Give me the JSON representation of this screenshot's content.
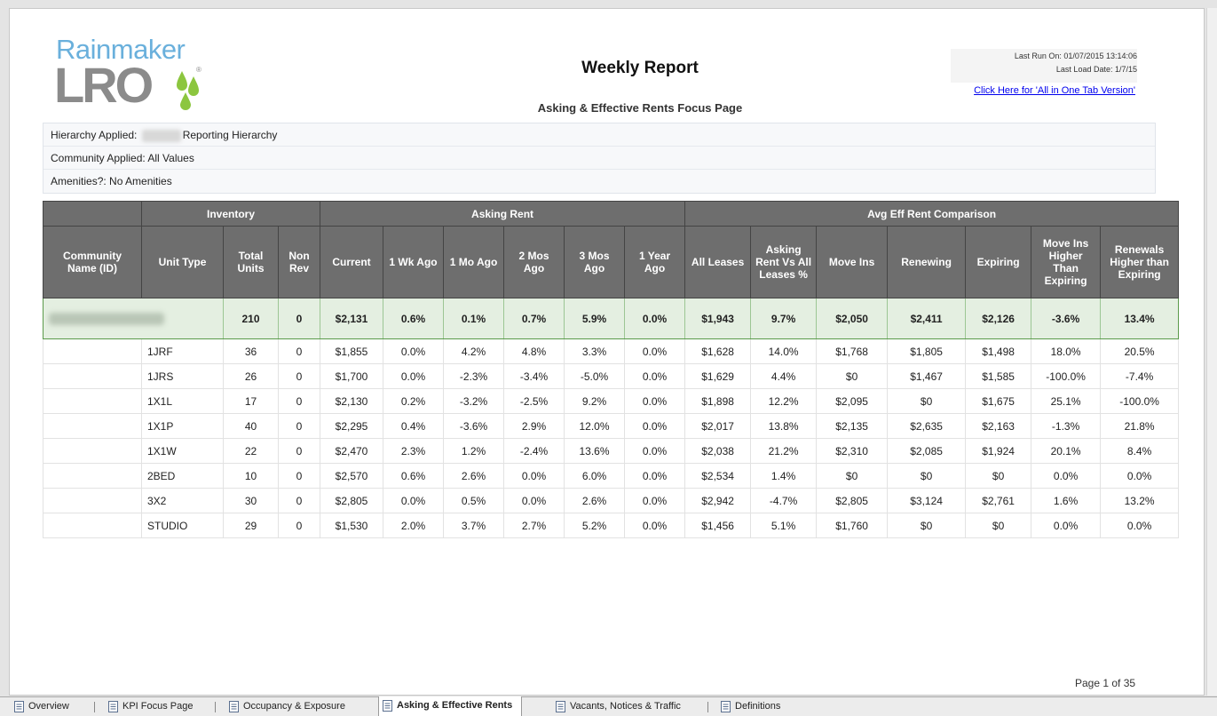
{
  "report": {
    "title": "Weekly Report",
    "subtitle": "Asking & Effective Rents Focus Page",
    "last_run": "Last Run On: 01/07/2015 13:14:06",
    "last_load": "Last Load Date: 1/7/15",
    "all_in_one_link": "Click Here for 'All in One Tab Version'",
    "page_indicator": "Page 1 of 35"
  },
  "logo": {
    "top_text": "Rainmaker",
    "bottom_text": "LRO",
    "reg_mark": "®"
  },
  "filters": {
    "hierarchy_label": "Hierarchy Applied: ",
    "hierarchy_value": "Reporting Hierarchy",
    "community": "Community Applied: All Values",
    "amenities": "Amenities?: No Amenities"
  },
  "table": {
    "group_headers": [
      "Inventory",
      "Asking Rent",
      "Avg Eff Rent Comparison"
    ],
    "columns": [
      "Community Name (ID)",
      "Unit Type",
      "Total Units",
      "Non Rev",
      "Current",
      "1 Wk Ago",
      "1 Mo Ago",
      "2 Mos Ago",
      "3 Mos Ago",
      "1 Year Ago",
      "All Leases",
      "Asking Rent Vs All Leases %",
      "Move Ins",
      "Renewing",
      "Expiring",
      "Move Ins Higher Than Expiring",
      "Renewals Higher than Expiring"
    ],
    "summary": [
      "",
      "210",
      "0",
      "$2,131",
      "0.6%",
      "0.1%",
      "0.7%",
      "5.9%",
      "0.0%",
      "$1,943",
      "9.7%",
      "$2,050",
      "$2,411",
      "$2,126",
      "-3.6%",
      "13.4%"
    ],
    "rows": [
      [
        "",
        "1JRF",
        "36",
        "0",
        "$1,855",
        "0.0%",
        "4.2%",
        "4.8%",
        "3.3%",
        "0.0%",
        "$1,628",
        "14.0%",
        "$1,768",
        "$1,805",
        "$1,498",
        "18.0%",
        "20.5%"
      ],
      [
        "",
        "1JRS",
        "26",
        "0",
        "$1,700",
        "0.0%",
        "-2.3%",
        "-3.4%",
        "-5.0%",
        "0.0%",
        "$1,629",
        "4.4%",
        "$0",
        "$1,467",
        "$1,585",
        "-100.0%",
        "-7.4%"
      ],
      [
        "",
        "1X1L",
        "17",
        "0",
        "$2,130",
        "0.2%",
        "-3.2%",
        "-2.5%",
        "9.2%",
        "0.0%",
        "$1,898",
        "12.2%",
        "$2,095",
        "$0",
        "$1,675",
        "25.1%",
        "-100.0%"
      ],
      [
        "",
        "1X1P",
        "40",
        "0",
        "$2,295",
        "0.4%",
        "-3.6%",
        "2.9%",
        "12.0%",
        "0.0%",
        "$2,017",
        "13.8%",
        "$2,135",
        "$2,635",
        "$2,163",
        "-1.3%",
        "21.8%"
      ],
      [
        "",
        "1X1W",
        "22",
        "0",
        "$2,470",
        "2.3%",
        "1.2%",
        "-2.4%",
        "13.6%",
        "0.0%",
        "$2,038",
        "21.2%",
        "$2,310",
        "$2,085",
        "$1,924",
        "20.1%",
        "8.4%"
      ],
      [
        "",
        "2BED",
        "10",
        "0",
        "$2,570",
        "0.6%",
        "2.6%",
        "0.0%",
        "6.0%",
        "0.0%",
        "$2,534",
        "1.4%",
        "$0",
        "$0",
        "$0",
        "0.0%",
        "0.0%"
      ],
      [
        "",
        "3X2",
        "30",
        "0",
        "$2,805",
        "0.0%",
        "0.5%",
        "0.0%",
        "2.6%",
        "0.0%",
        "$2,942",
        "-4.7%",
        "$2,805",
        "$3,124",
        "$2,761",
        "1.6%",
        "13.2%"
      ],
      [
        "",
        "STUDIO",
        "29",
        "0",
        "$1,530",
        "2.0%",
        "3.7%",
        "2.7%",
        "5.2%",
        "0.0%",
        "$1,456",
        "5.1%",
        "$1,760",
        "$0",
        "$0",
        "0.0%",
        "0.0%"
      ]
    ]
  },
  "tabs": [
    {
      "label": "Overview",
      "icon": "workbook-icon",
      "active": false
    },
    {
      "label": "KPI Focus Page",
      "icon": "sheet-icon",
      "active": false
    },
    {
      "label": "Occupancy & Exposure",
      "icon": "sheet-icon",
      "active": false
    },
    {
      "label": "Asking & Effective Rents",
      "icon": "sheet-icon",
      "active": true
    },
    {
      "label": "Vacants, Notices & Traffic",
      "icon": "sheet-icon",
      "active": false
    },
    {
      "label": "Definitions",
      "icon": "sheet-icon",
      "active": false
    }
  ],
  "colors": {
    "header_bg": "#6e6e6e",
    "summary_bg": "#e4efe1",
    "summary_border": "#5a9a4a",
    "logo_blue": "#6ab0dc",
    "logo_gray": "#8b8b8b",
    "logo_green": "#8cc63f",
    "link": "#0000ee"
  }
}
